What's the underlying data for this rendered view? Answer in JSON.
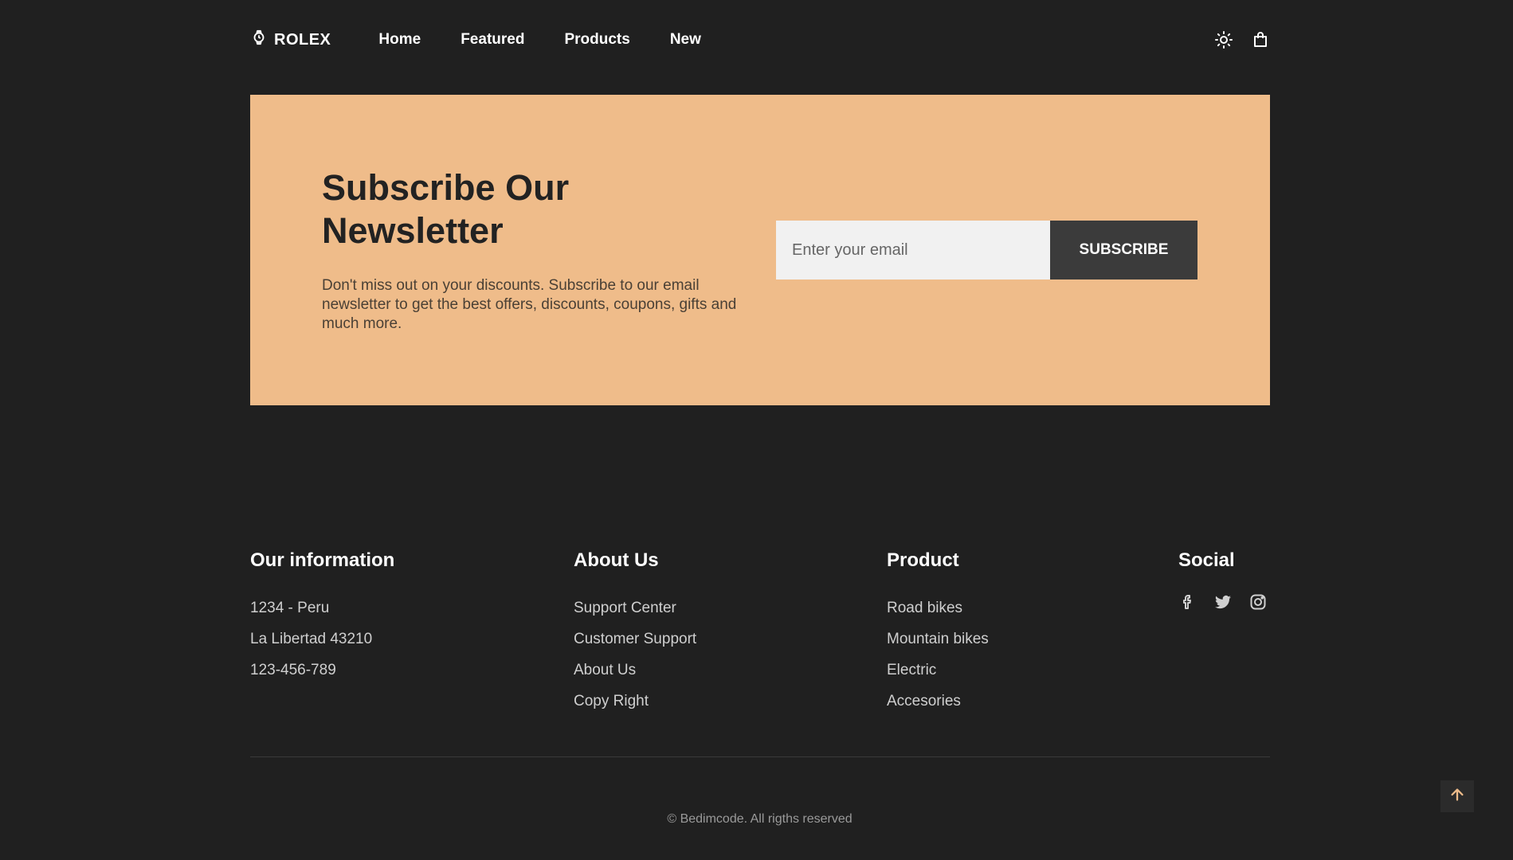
{
  "header": {
    "logo_text": "ROLEX",
    "logo_icon": "watch-icon",
    "nav": [
      "Home",
      "Featured",
      "Products",
      "New"
    ],
    "icons": [
      "theme-toggle-icon",
      "shopping-bag-icon"
    ]
  },
  "newsletter": {
    "title": "Subscribe Our Newsletter",
    "description": "Don't miss out on your discounts. Subscribe to our email newsletter to get the best offers, discounts, coupons, gifts and much more.",
    "email_placeholder": "Enter your email",
    "button_label": "SUBSCRIBE",
    "background_color": "#efbc8a",
    "button_color": "#3b3b3b"
  },
  "footer": {
    "our_information": {
      "title": "Our information",
      "items": [
        "1234 - Peru",
        "La Libertad 43210",
        "123-456-789"
      ]
    },
    "about_us": {
      "title": "About Us",
      "items": [
        "Support Center",
        "Customer Support",
        "About Us",
        "Copy Right"
      ]
    },
    "product": {
      "title": "Product",
      "items": [
        "Road bikes",
        "Mountain bikes",
        "Electric",
        "Accesories"
      ]
    },
    "social": {
      "title": "Social",
      "icons": [
        "facebook-icon",
        "twitter-icon",
        "instagram-icon"
      ]
    },
    "copyright": "© Bedimcode. All rigths reserved"
  },
  "scroll_up_icon": "arrow-up-icon",
  "colors": {
    "background": "#202020",
    "accent": "#efbc8a"
  }
}
